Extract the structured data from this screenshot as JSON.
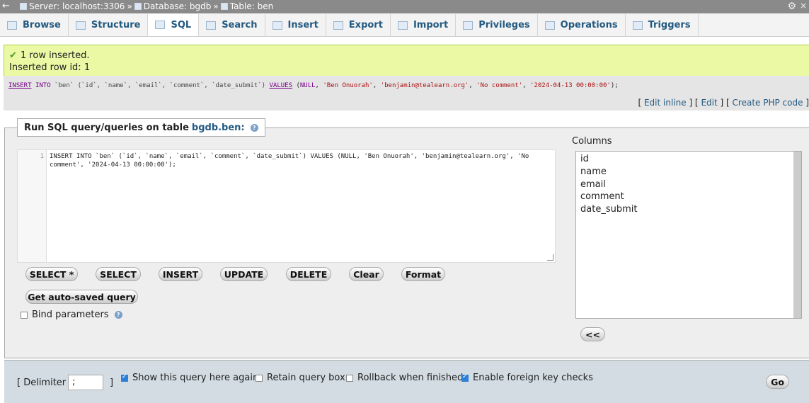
{
  "topbar": {
    "back": "←",
    "server": "Server: localhost:3306",
    "sep1": "»",
    "database": "Database: bgdb",
    "sep2": "»",
    "table": "Table: ben",
    "gear": "⚙",
    "close": "×"
  },
  "tabs": [
    {
      "label": "Browse",
      "icon": "browse-icon"
    },
    {
      "label": "Structure",
      "icon": "structure-icon"
    },
    {
      "label": "SQL",
      "icon": "sql-icon",
      "active": true
    },
    {
      "label": "Search",
      "icon": "search-icon"
    },
    {
      "label": "Insert",
      "icon": "insert-icon"
    },
    {
      "label": "Export",
      "icon": "export-icon"
    },
    {
      "label": "Import",
      "icon": "import-icon"
    },
    {
      "label": "Privileges",
      "icon": "privileges-icon"
    },
    {
      "label": "Operations",
      "icon": "operations-icon"
    },
    {
      "label": "Triggers",
      "icon": "triggers-icon"
    }
  ],
  "message": {
    "line1": "1 row inserted.",
    "line2": "Inserted row id: 1"
  },
  "sql_display": {
    "insert": "INSERT",
    "into": "INTO",
    "table": "`ben`",
    "cols": "(`id`, `name`, `email`, `comment`, `date_submit`)",
    "values": "VALUES",
    "open": "(",
    "null": "NULL",
    "v1": "'Ben Onuorah'",
    "v2": "'benjamin@tealearn.org'",
    "v3": "'No comment'",
    "v4": "'2024-04-13 00:00:00'",
    "close": ");"
  },
  "edit_links": {
    "o1": "[",
    "edit_inline": "Edit inline",
    "c1": "] [",
    "edit": "Edit",
    "c2": "] [",
    "php": "Create PHP code",
    "c3": "]"
  },
  "query_box": {
    "legend_prefix": "Run SQL query/queries on table",
    "legend_db": "bgdb.ben:",
    "help": "?",
    "line_no": "1",
    "line1": "INSERT INTO `ben` (`id`, `name`, `email`, `comment`, `date_submit`) VALUES (NULL, 'Ben Onuorah', 'benjamin@tealearn.org', 'No",
    "line2": "comment', '2024-04-13 00:00:00');"
  },
  "buttons": {
    "select_all": "SELECT *",
    "select": "SELECT",
    "insert": "INSERT",
    "update": "UPDATE",
    "delete": "DELETE",
    "clear": "Clear",
    "format": "Format",
    "autosaved": "Get auto-saved query",
    "insert_col": "<<",
    "go": "Go"
  },
  "bind_parameters": {
    "label": "Bind parameters",
    "checked": false
  },
  "columns": {
    "label": "Columns",
    "items": [
      "id",
      "name",
      "email",
      "comment",
      "date_submit"
    ]
  },
  "options": {
    "delimiter_label_open": "[ Delimiter",
    "delimiter_value": ";",
    "delimiter_label_close": "]",
    "show_query": "Show this query here again",
    "show_query_checked": true,
    "retain": "Retain query box",
    "retain_checked": false,
    "rollback": "Rollback when finished",
    "rollback_checked": false,
    "fk": "Enable foreign key checks",
    "fk_checked": true
  }
}
